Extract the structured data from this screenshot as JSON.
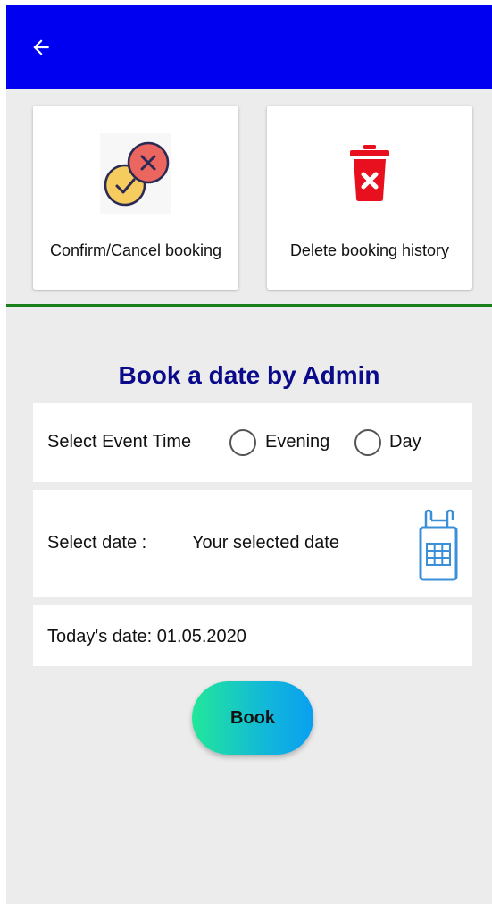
{
  "colors": {
    "appbar": "#0000f0",
    "background": "#ececec",
    "divider": "#1a7f1a",
    "title": "#0a0a8a",
    "calendar": "#3b8fd8",
    "delete_red": "#e8101e"
  },
  "appbar": {
    "back_icon": "arrow-back-icon"
  },
  "cards": {
    "confirm_cancel": {
      "label": "Confirm/Cancel booking",
      "icon": "check-cross-badges-icon"
    },
    "delete_history": {
      "label": "Delete booking history",
      "icon": "trash-delete-icon"
    }
  },
  "booking": {
    "title": "Book a date by Admin",
    "event_time_label": "Select Event Time",
    "options": [
      {
        "label": "Evening",
        "selected": false
      },
      {
        "label": "Day",
        "selected": false
      }
    ],
    "date_label": "Select date :",
    "date_value": "Your selected date",
    "calendar_icon": "calendar-icon",
    "today_label": "Today's date: 01.05.2020",
    "book_button": "Book"
  }
}
